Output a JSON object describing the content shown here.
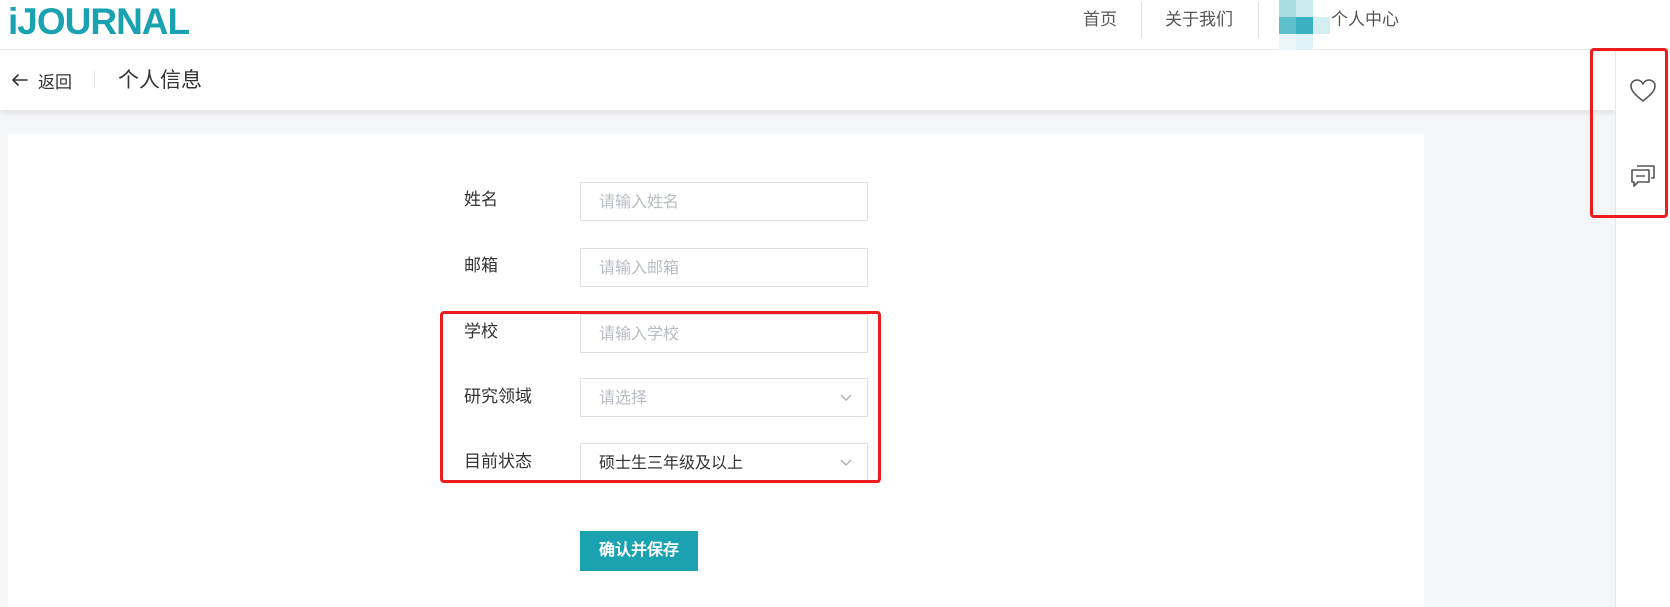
{
  "brand": {
    "logo_text": "iJOURNAL",
    "color": "#1aa2b0"
  },
  "nav": {
    "home": "首页",
    "about": "关于我们",
    "user_center": "个人中心"
  },
  "subheader": {
    "back_label": "返回",
    "title": "个人信息"
  },
  "form": {
    "name": {
      "label": "姓名",
      "placeholder": "请输入姓名"
    },
    "email": {
      "label": "邮箱",
      "placeholder": "请输入邮箱"
    },
    "school": {
      "label": "学校",
      "placeholder": "请输入学校"
    },
    "field": {
      "label": "研究领域",
      "placeholder": "请选择"
    },
    "status": {
      "label": "目前状态",
      "value": "硕士生三年级及以上"
    },
    "submit_label": "确认并保存"
  },
  "sidebar": {
    "icons": [
      "heart-icon",
      "chat-icon"
    ]
  },
  "colors": {
    "accent": "#1aa2b0",
    "annotation": "#ee1c1c"
  }
}
